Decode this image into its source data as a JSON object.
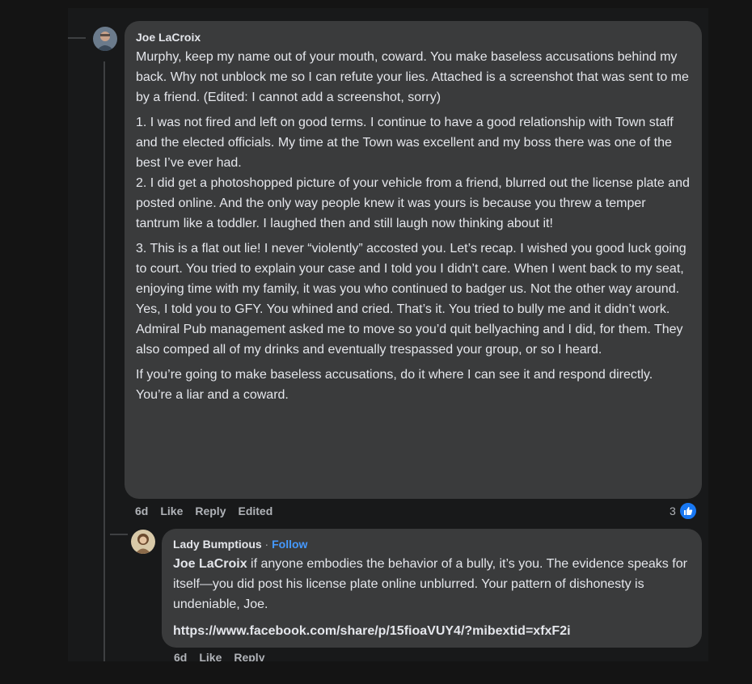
{
  "colors": {
    "bubble": "#3a3b3c",
    "text": "#e4e6eb",
    "meta": "#b0b3b8",
    "like_blue": "#1877f2",
    "follow_blue": "#4599ff"
  },
  "comment": {
    "author": "Joe LaCroix",
    "paragraphs": [
      "Murphy, keep my name out of your mouth, coward. You make baseless accusations behind my back. Why not unblock me so I can refute your lies. Attached is a screenshot that was sent to me by a friend. (Edited: I cannot add a screenshot, sorry)",
      "1. I was not fired and left on good terms. I continue to have a good relationship with Town staff and the elected officials. My time at the Town was excellent and my boss there was one of the best I’ve ever had.\n2. I did get a photoshopped picture of your vehicle from a friend, blurred out the license plate and posted online. And the only way people knew it was yours is because you threw a temper tantrum like a toddler. I laughed then and still laugh now thinking about it!",
      "3. This is a flat out lie! I never “violently” accosted you. Let’s recap. I wished you good luck going to court. You tried to explain your case and I told you I didn’t care. When I went back to my seat, enjoying time with my family, it was you who continued to badger us. Not the other way around. Yes, I told you to GFY. You whined and cried. That’s it. You tried to bully me and it didn’t work. Admiral Pub management asked me to move so you’d quit bellyaching and I did, for them. They also comped all of my drinks and eventually trespassed your group, or so I heard.",
      "If you’re going to make baseless accusations, do it where I can see it and respond directly. You’re a liar and a coward."
    ],
    "time": "6d",
    "like_label": "Like",
    "reply_label": "Reply",
    "edited_label": "Edited",
    "reaction_count": "3",
    "reaction_icon": "thumbs-up-icon"
  },
  "reply": {
    "author": "Lady Bumptious",
    "separator": " · ",
    "follow_label": "Follow",
    "mention": "Joe LaCroix",
    "text": " if anyone embodies the behavior of a bully, it’s you. The evidence speaks for itself—you did post his license plate online unblurred. Your pattern of dishonesty is undeniable, Joe.",
    "link": "https://www.facebook.com/share/p/15fioaVUY4/?mibextid=xfxF2i",
    "time": "6d",
    "like_label": "Like",
    "reply_label": "Reply"
  }
}
